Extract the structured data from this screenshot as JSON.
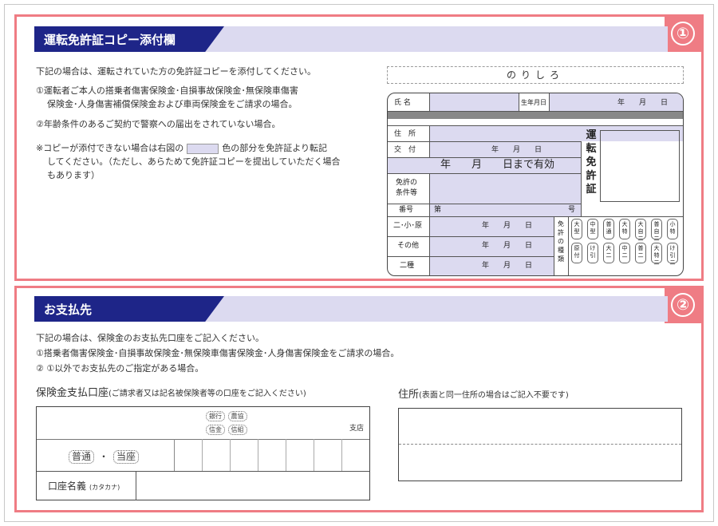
{
  "section1": {
    "number": "①",
    "title": "運転免許証コピー添付欄",
    "intro": "下記の場合は、運転されていた方の免許証コピーを添付してください。",
    "item1_line1": "①運転者ご本人の搭乗者傷害保険金･自損事故保険金･無保険車傷害",
    "item1_line2": "保険金･人身傷害補償保険金および車両保険金をご請求の場合。",
    "item2": "②年齢条件のあるご契約で警察への届出をされていない場合。",
    "note_pre": "※コピーが添付できない場合は右図の",
    "note_post": "色の部分を免許証より転記",
    "note_line2": "してください。（ただし、あらためて免許証コピーを提出していただく場合",
    "note_line3": "もあります）",
    "noshiro": "のりしろ",
    "license": {
      "name_label": "氏 名",
      "dob_label": "生年月日",
      "date_ymd": "年　　月　　日",
      "address_label": "住　所",
      "issue_label": "交　付",
      "valid_until": "年　　月　　日まで有効",
      "conditions_label_1": "免許の",
      "conditions_label_2": "条件等",
      "number_label": "番号",
      "number_prefix": "第",
      "number_suffix": "号",
      "class_rows": [
        "二･小･原",
        "その他",
        "二種"
      ],
      "types_label": "免許の種類",
      "title_vertical": "運転免許証",
      "types_row1": [
        "大型",
        "中型",
        "普通",
        "大特",
        "大自二",
        "普自二",
        "小特"
      ],
      "types_row2": [
        "原付",
        "け引",
        "大二",
        "中二",
        "普二",
        "大特二",
        "け引二"
      ]
    }
  },
  "section2": {
    "number": "②",
    "title": "お支払先",
    "intro": "下記の場合は、保険金のお支払先口座をご記入ください。",
    "item1": "①搭乗者傷害保険金･自損事故保険金･無保険車傷害保険金･人身傷害保険金をご請求の場合。",
    "item2": "② ①以外でお支払先のご指定がある場合。",
    "account_heading": "保険金支払口座",
    "account_note": "(ご請求者又は記名被保険者等の口座をご記入ください)",
    "bank": "銀行",
    "nokyo": "農協",
    "shinkin": "信金",
    "shinkumi": "信組",
    "branch": "支店",
    "futsu": "普通",
    "dot": "・",
    "toza": "当座",
    "holder_label": "口座名義",
    "holder_note": "(カタカナ)",
    "address_heading": "住所",
    "address_note": "(表面と同一住所の場合はご記入不要です)"
  },
  "colors": {
    "accent": "#ef7c84",
    "navy": "#1e2588",
    "lavender": "#dcdaf0"
  }
}
